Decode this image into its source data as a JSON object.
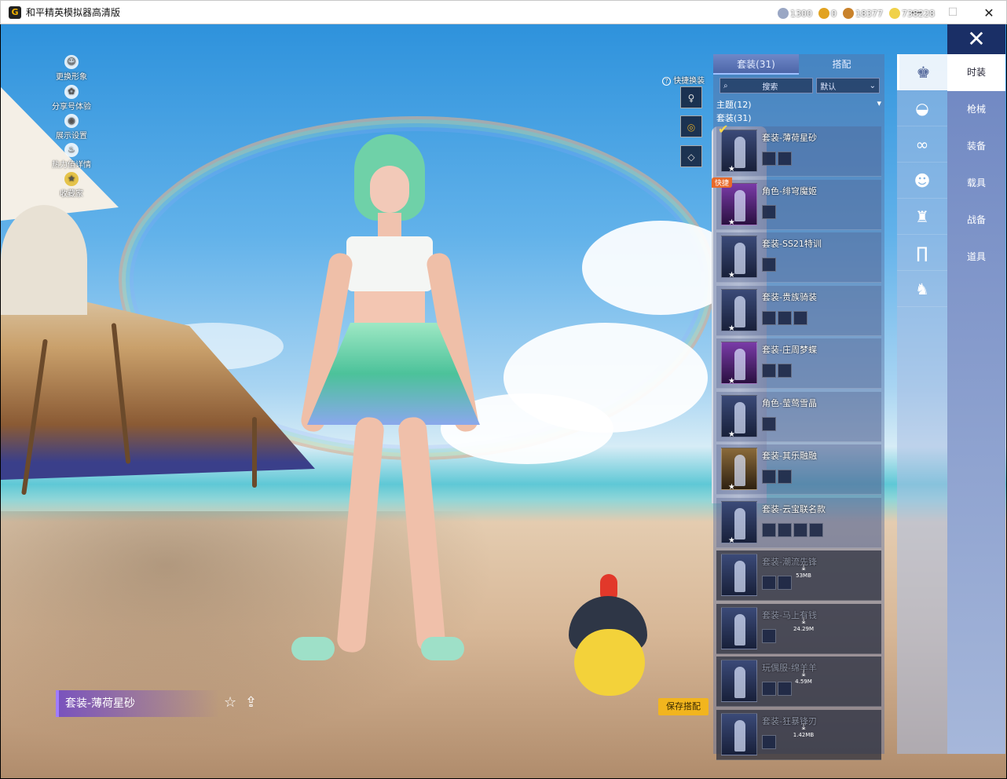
{
  "window": {
    "title": "和平精英模拟器高清版",
    "app_icon": "G",
    "minimize": "—",
    "maximize": "☐",
    "close": "✕"
  },
  "left_menu": [
    {
      "label": "更换形象",
      "icon": "person-icon"
    },
    {
      "label": "分享号体验",
      "icon": "share-gear-icon"
    },
    {
      "label": "展示设置",
      "icon": "eye-icon"
    },
    {
      "label": "热力值详情",
      "icon": "flame-icon"
    },
    {
      "label": "收藏家",
      "icon": "badge-icon"
    }
  ],
  "currencies": [
    {
      "value": "1300",
      "color": "#9aa7c4",
      "icon": "silver-coin-icon"
    },
    {
      "value": "0",
      "color": "#e2a321",
      "icon": "gold-coin-icon"
    },
    {
      "value": "18377",
      "color": "#c9822b",
      "icon": "bronze-coin-icon"
    },
    {
      "value": "738228",
      "color": "#f0d14a",
      "icon": "star-coin-icon"
    }
  ],
  "close_panel": "✕",
  "quick_change": {
    "label": "快捷换装",
    "help_icon": "?"
  },
  "panel": {
    "tabs": [
      "套装(31)",
      "搭配"
    ],
    "search_placeholder": "搜索",
    "sort_value": "默认",
    "theme_label": "主题(12)",
    "suit_count": "套装(31)",
    "quick_tag": "快捷"
  },
  "outfits": [
    {
      "name": "套装-薄荷星砂",
      "parts": 2,
      "selected": true,
      "style": "blue"
    },
    {
      "name": "角色-绯穹魔姬",
      "parts": 1,
      "style": "purple",
      "quick": true
    },
    {
      "name": "套装-SS21特训",
      "parts": 1,
      "style": "blue"
    },
    {
      "name": "套装-贵族骑装",
      "parts": 3,
      "style": "blue"
    },
    {
      "name": "套装-庄周梦蝶",
      "parts": 2,
      "style": "purple"
    },
    {
      "name": "角色-莹莺雪晶",
      "parts": 1,
      "style": "blue"
    },
    {
      "name": "套装-其乐融融",
      "parts": 2,
      "style": "gold"
    },
    {
      "name": "套装-云宝联名款",
      "parts": 4,
      "style": "blue"
    },
    {
      "name": "套装-潮流先锋",
      "parts": 2,
      "locked": true,
      "size": "53MB"
    },
    {
      "name": "套装-马上有钱",
      "parts": 1,
      "locked": true,
      "size": "24.29M"
    },
    {
      "name": "玩偶服-绵羊羊",
      "parts": 2,
      "locked": true,
      "size": "4.59M"
    },
    {
      "name": "套装-狂暴锋刃",
      "parts": 1,
      "locked": true,
      "size": "1.42MB"
    }
  ],
  "subcategory_icons": [
    "suit-icon",
    "hat-icon",
    "glasses-icon",
    "mask-icon",
    "top-icon",
    "pants-icon",
    "shoes-icon"
  ],
  "main_tabs": [
    "时装",
    "枪械",
    "装备",
    "载具",
    "战备",
    "道具"
  ],
  "current_outfit": "套装-薄荷星砂",
  "favorite_icon": "☆",
  "share_icon": "⇪",
  "save_button": "保存搭配"
}
